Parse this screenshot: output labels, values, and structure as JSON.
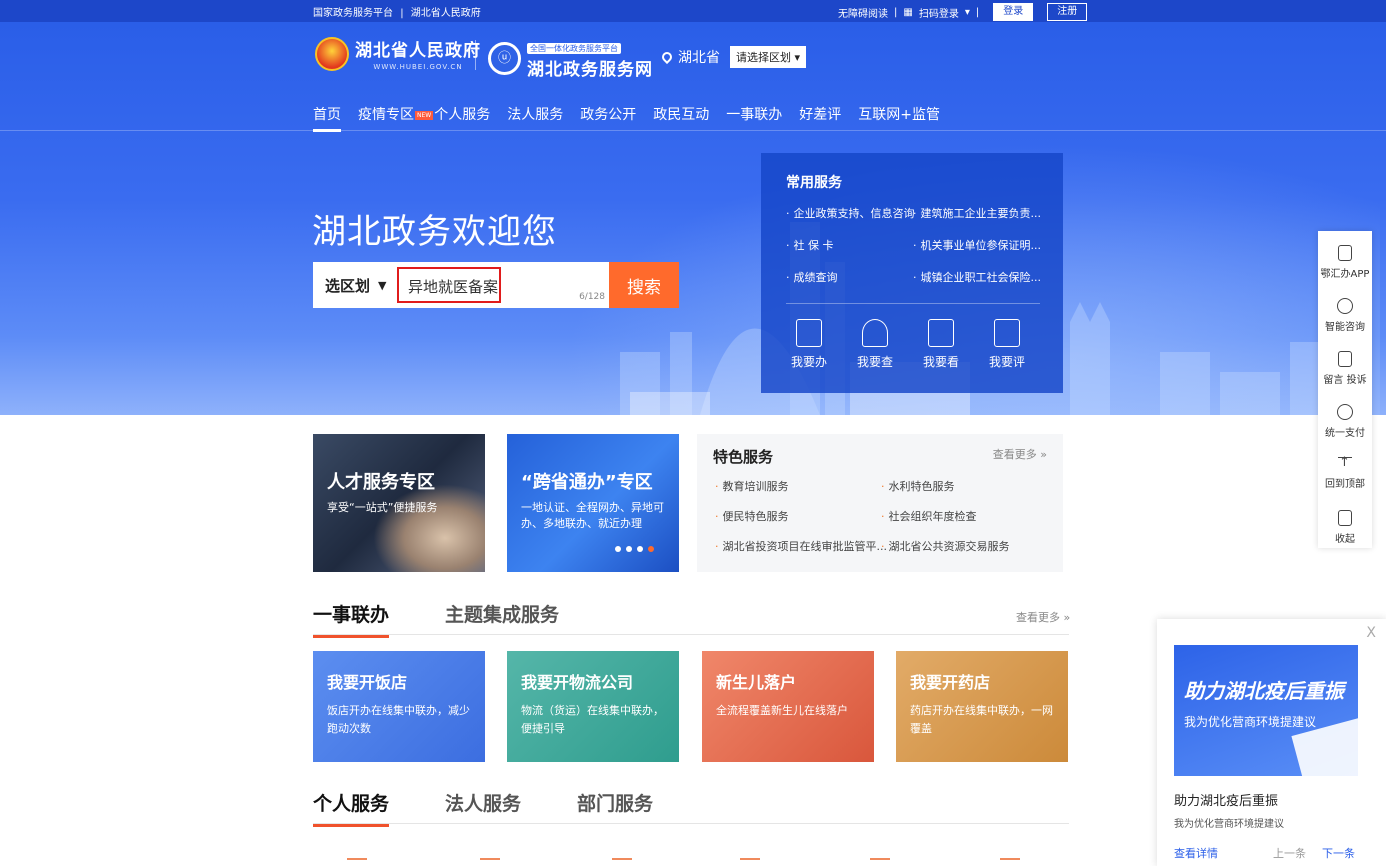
{
  "topbar": {
    "links": [
      "国家政务服务平台",
      "|",
      "湖北省人民政府"
    ],
    "accessibility": "无障碍阅读",
    "qr_login": "扫码登录",
    "login": "登录",
    "register": "注册"
  },
  "header": {
    "gov_name": "湖北省人民政府",
    "gov_domain": "WWW.HUBEI.GOV.CN",
    "platform_tag": "全国一体化政务服务平台",
    "platform_name": "湖北政务服务网",
    "location": "湖北省",
    "region_select": "请选择区划 ▾"
  },
  "nav": {
    "items": [
      "首页",
      "疫情专区",
      "个人服务",
      "法人服务",
      "政务公开",
      "政民互动",
      "一事联办",
      "好差评",
      "互联网+监管"
    ],
    "new_badge": "NEW"
  },
  "hero": {
    "welcome": "湖北政务欢迎您",
    "region_label": "选区划",
    "search_value": "异地就医备案",
    "char_count": "6/128",
    "search_button": "搜索"
  },
  "common_services": {
    "title": "常用服务",
    "links": [
      "企业政策支持、信息咨询",
      "建筑施工企业主要负责...",
      "社 保 卡",
      "机关事业单位参保证明...",
      "成绩查询",
      "城镇企业职工社会保险..."
    ],
    "quick": [
      "我要办",
      "我要查",
      "我要看",
      "我要评"
    ]
  },
  "toolbar": {
    "items": [
      "鄂汇办APP",
      "智能咨询",
      "留言 投诉",
      "统一支付",
      "回到顶部",
      "收起"
    ],
    "icons": [
      "phone-icon",
      "headset-icon",
      "message-icon",
      "yuan-icon",
      "back-to-top-icon",
      "collapse-icon"
    ]
  },
  "promo_cards": [
    {
      "title": "人才服务专区",
      "subtitle": "享受“一站式”便捷服务"
    },
    {
      "title": "“跨省通办”专区",
      "subtitle": "一地认证、全程网办、异地可办、多地联办、就近办理"
    }
  ],
  "featured": {
    "title": "特色服务",
    "more": "查看更多",
    "items": [
      "教育培训服务",
      "水利特色服务",
      "便民特色服务",
      "社会组织年度检查",
      "湖北省投资项目在线审批监管平...",
      "湖北省公共资源交易服务"
    ]
  },
  "section1": {
    "tabs": [
      "一事联办",
      "主题集成服务"
    ],
    "more": "查看更多",
    "cards": [
      {
        "title": "我要开饭店",
        "desc": "饭店开办在线集中联办，减少跑动次数"
      },
      {
        "title": "我要开物流公司",
        "desc": "物流（货运）在线集中联办，便捷引导"
      },
      {
        "title": "新生儿落户",
        "desc": "全流程覆盖新生儿在线落户"
      },
      {
        "title": "我要开药店",
        "desc": "药店开办在线集中联办，一网覆盖"
      }
    ]
  },
  "section2": {
    "tabs": [
      "个人服务",
      "法人服务",
      "部门服务"
    ]
  },
  "popup": {
    "close": "X",
    "banner_title": "助力湖北疫后重振",
    "banner_sub": "我为优化营商环境提建议",
    "title": "助力湖北疫后重振",
    "sub": "我为优化营商环境提建议",
    "detail": "查看详情",
    "prev": "上一条",
    "next": "下一条"
  }
}
